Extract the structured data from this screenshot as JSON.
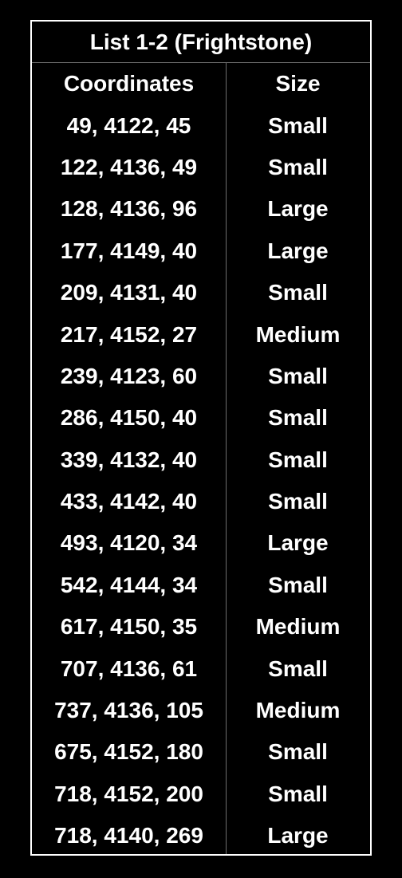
{
  "table": {
    "title": "List 1-2 (Frightstone)",
    "headers": {
      "coordinates": "Coordinates",
      "size": "Size"
    },
    "rows": [
      {
        "coordinates": "49, 4122, 45",
        "size": "Small"
      },
      {
        "coordinates": "122, 4136, 49",
        "size": "Small"
      },
      {
        "coordinates": "128, 4136, 96",
        "size": "Large"
      },
      {
        "coordinates": "177, 4149, 40",
        "size": "Large"
      },
      {
        "coordinates": "209, 4131, 40",
        "size": "Small"
      },
      {
        "coordinates": "217, 4152, 27",
        "size": "Medium"
      },
      {
        "coordinates": "239, 4123, 60",
        "size": "Small"
      },
      {
        "coordinates": "286, 4150, 40",
        "size": "Small"
      },
      {
        "coordinates": "339, 4132, 40",
        "size": "Small"
      },
      {
        "coordinates": "433, 4142, 40",
        "size": "Small"
      },
      {
        "coordinates": "493, 4120, 34",
        "size": "Large"
      },
      {
        "coordinates": "542, 4144, 34",
        "size": "Small"
      },
      {
        "coordinates": "617, 4150, 35",
        "size": "Medium"
      },
      {
        "coordinates": "707, 4136, 61",
        "size": "Small"
      },
      {
        "coordinates": "737, 4136, 105",
        "size": "Medium"
      },
      {
        "coordinates": "675, 4152, 180",
        "size": "Small"
      },
      {
        "coordinates": "718, 4152, 200",
        "size": "Small"
      },
      {
        "coordinates": "718, 4140, 269",
        "size": "Large"
      }
    ]
  }
}
